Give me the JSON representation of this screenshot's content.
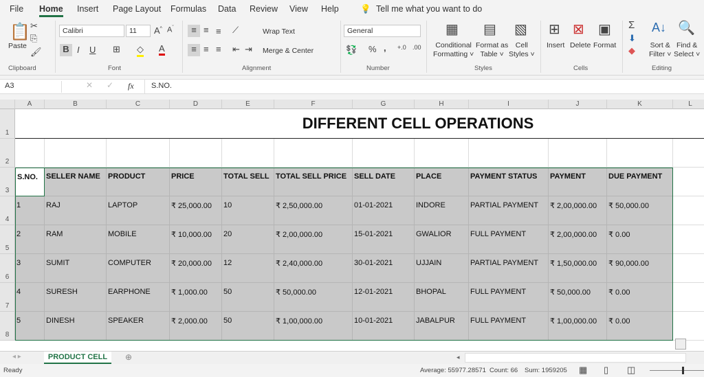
{
  "menu": [
    "File",
    "Home",
    "Insert",
    "Page Layout",
    "Formulas",
    "Data",
    "Review",
    "View",
    "Help"
  ],
  "tell_me": "Tell me what you want to do",
  "ribbon": {
    "paste": "Paste",
    "font_name": "Calibri",
    "font_size": "11",
    "bold": "B",
    "italic": "I",
    "underline": "U",
    "wrap_text": "Wrap Text",
    "merge_center": "Merge & Center",
    "number_format": "General",
    "percent": "%",
    "comma": ",",
    "conditional": "Conditional",
    "formatting": "Formatting ˅",
    "format_as": "Format as",
    "table": "Table ˅",
    "cell": "Cell",
    "styles": "Styles ˅",
    "insert": "Insert",
    "delete": "Delete",
    "format": "Format",
    "sort": "Sort &",
    "filter": "Filter ˅",
    "find": "Find &",
    "select": "Select ˅",
    "groups": [
      "Clipboard",
      "Font",
      "Alignment",
      "Number",
      "Styles",
      "Cells",
      "Editing"
    ]
  },
  "formula_bar": {
    "name_box": "A3",
    "fx": "fx",
    "content": "S.NO."
  },
  "columns": [
    "A",
    "B",
    "C",
    "D",
    "E",
    "F",
    "G",
    "H",
    "I",
    "J",
    "K",
    "L"
  ],
  "rows": [
    "1",
    "2",
    "3",
    "4",
    "5",
    "6",
    "7",
    "8"
  ],
  "title": "DIFFERENT CELL OPERATIONS",
  "table": {
    "headers": [
      "S.NO.",
      "SELLER NAME",
      "PRODUCT",
      "PRICE",
      "TOTAL SELL",
      "TOTAL SELL PRICE",
      "SELL DATE",
      "PLACE",
      "PAYMENT STATUS",
      "PAYMENT",
      "DUE PAYMENT"
    ],
    "rows": [
      [
        "1",
        "RAJ",
        "LAPTOP",
        "₹ 25,000.00",
        "10",
        "₹ 2,50,000.00",
        "01-01-2021",
        "INDORE",
        "PARTIAL PAYMENT",
        "₹ 2,00,000.00",
        "₹ 50,000.00"
      ],
      [
        "2",
        "RAM",
        "MOBILE",
        "₹ 10,000.00",
        "20",
        "₹ 2,00,000.00",
        "15-01-2021",
        "GWALIOR",
        "FULL PAYMENT",
        "₹ 2,00,000.00",
        "₹ 0.00"
      ],
      [
        "3",
        "SUMIT",
        "COMPUTER",
        "₹ 20,000.00",
        "12",
        "₹ 2,40,000.00",
        "30-01-2021",
        "UJJAIN",
        "PARTIAL PAYMENT",
        "₹ 1,50,000.00",
        "₹ 90,000.00"
      ],
      [
        "4",
        "SURESH",
        "EARPHONE",
        "₹ 1,000.00",
        "50",
        "₹ 50,000.00",
        "12-01-2021",
        "BHOPAL",
        "FULL PAYMENT",
        "₹ 50,000.00",
        "₹ 0.00"
      ],
      [
        "5",
        "DINESH",
        "SPEAKER",
        "₹ 2,000.00",
        "50",
        "₹ 1,00,000.00",
        "10-01-2021",
        "JABALPUR",
        "FULL PAYMENT",
        "₹ 1,00,000.00",
        "₹ 0.00"
      ]
    ]
  },
  "sheet_tab": "PRODUCT CELL",
  "status": {
    "ready": "Ready",
    "average": "Average: 55977.28571",
    "count": "Count: 66",
    "sum": "Sum: 1959205"
  },
  "colors": {
    "accent": "#217346",
    "selection": "#c9c9c9"
  }
}
